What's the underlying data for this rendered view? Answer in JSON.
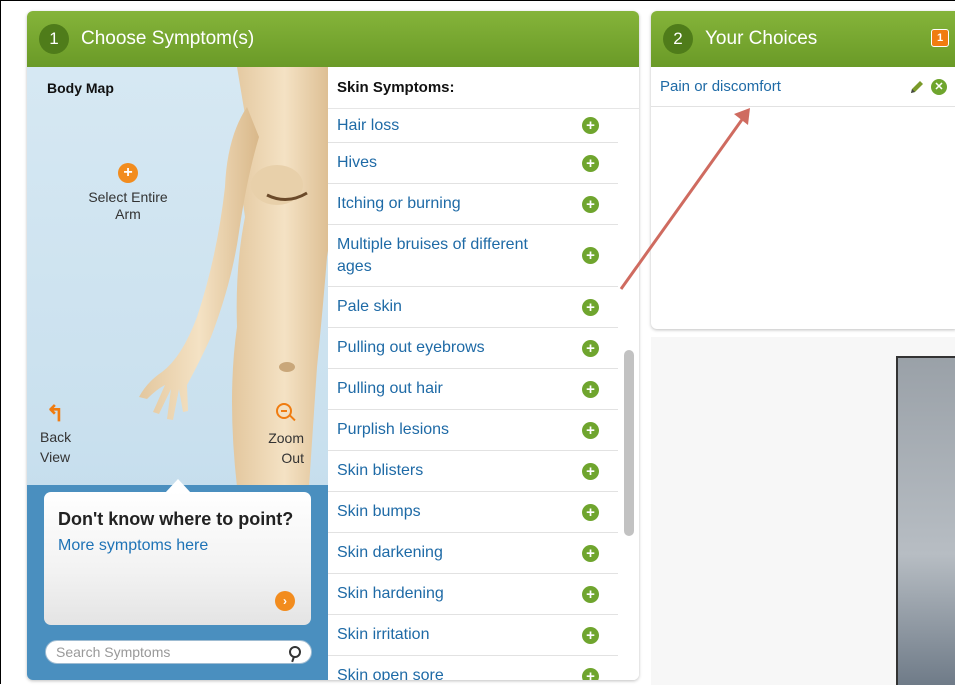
{
  "panel1": {
    "step_number": "1",
    "title": "Choose Symptom(s)",
    "body_map": {
      "title": "Body Map",
      "select_arm_label": "Select Entire Arm",
      "back_view_label": "Back View",
      "zoom_out_label": "Zoom Out"
    },
    "help_card": {
      "title": "Don't know where to point?",
      "link": "More symptoms here"
    },
    "search": {
      "placeholder": "Search Symptoms"
    },
    "symptoms": {
      "title": "Skin Symptoms:",
      "items": [
        "Hair loss",
        "Hives",
        "Itching or burning",
        "Multiple bruises of different ages",
        "Pale skin",
        "Pulling out eyebrows",
        "Pulling out hair",
        "Purplish lesions",
        "Skin blisters",
        "Skin bumps",
        "Skin darkening",
        "Skin hardening",
        "Skin irritation",
        "Skin open sore"
      ]
    }
  },
  "panel2": {
    "step_number": "2",
    "title": "Your Choices",
    "badge_count": "1",
    "choices": [
      "Pain or discomfort"
    ]
  },
  "colors": {
    "header_green": "#6a9a27",
    "link_blue": "#1e6aa6",
    "accent_orange": "#f07c10",
    "add_green": "#6fa52e",
    "annotation_arrow": "#cf6b60"
  },
  "icons": [
    "plus-circle-icon",
    "back-arrow-icon",
    "zoom-out-icon",
    "go-arrow-icon",
    "search-icon",
    "add-icon",
    "pencil-icon",
    "remove-icon"
  ]
}
